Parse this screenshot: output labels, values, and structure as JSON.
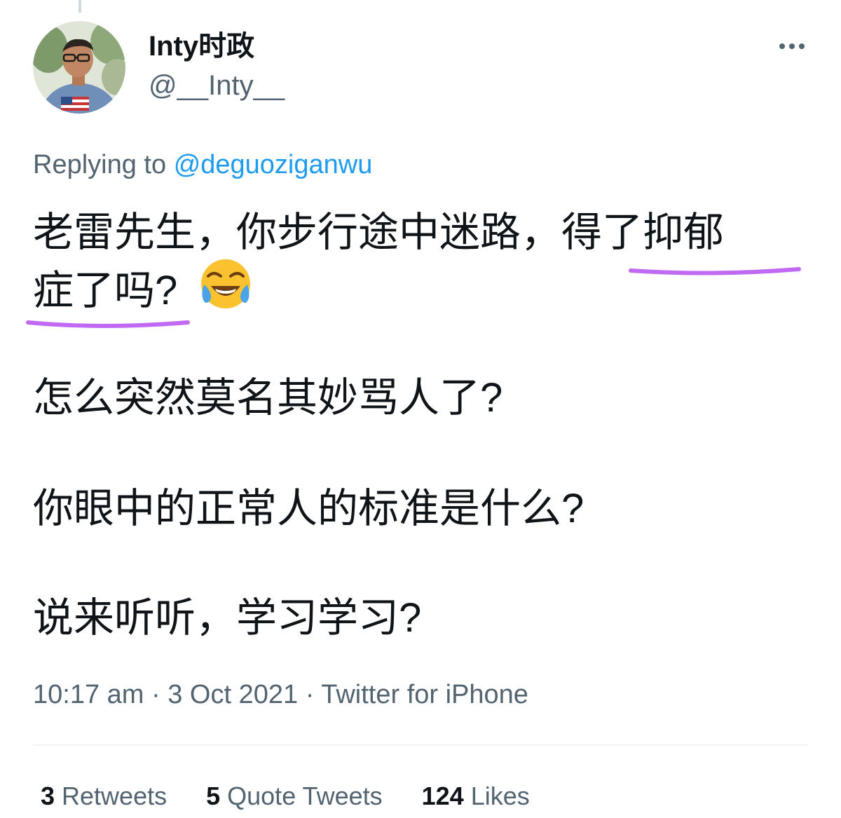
{
  "author": {
    "display_name": "Inty时政",
    "handle": "@__Inty__"
  },
  "reply": {
    "prefix": "Replying to",
    "mention": "@deguoziganwu"
  },
  "tweet": {
    "lines": [
      "老雷先生，你步行途中迷路，得了抑郁",
      "症了吗?",
      "怎么突然莫名其妙骂人了?",
      "你眼中的正常人的标准是什么?",
      "说来听听，学习学习?"
    ],
    "emoji": "face-with-tears-of-joy",
    "highlight_color": "#c069f2"
  },
  "meta": {
    "time": "10:17 am",
    "separator": "·",
    "date": "3 Oct 2021",
    "source": "Twitter for iPhone"
  },
  "stats": {
    "retweets_count": "3",
    "retweets_label": "Retweets",
    "quotes_count": "5",
    "quotes_label": "Quote Tweets",
    "likes_count": "124",
    "likes_label": "Likes"
  },
  "colors": {
    "text": "#0f1419",
    "secondary": "#536471",
    "link": "#1d9bf0"
  }
}
